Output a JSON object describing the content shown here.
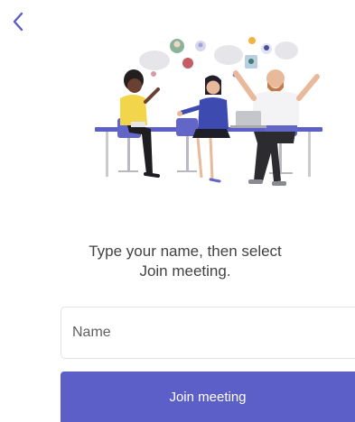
{
  "nav": {
    "back_icon": "chevron-left-icon"
  },
  "illustration": {
    "icon": "meeting-people-illustration"
  },
  "prompt": {
    "text": "Type your name, then select\nJoin meeting."
  },
  "name_field": {
    "value": "",
    "placeholder": "Name"
  },
  "join_button": {
    "label": "Join meeting"
  },
  "colors": {
    "accent": "#5b5fc7",
    "text": "#424242"
  }
}
